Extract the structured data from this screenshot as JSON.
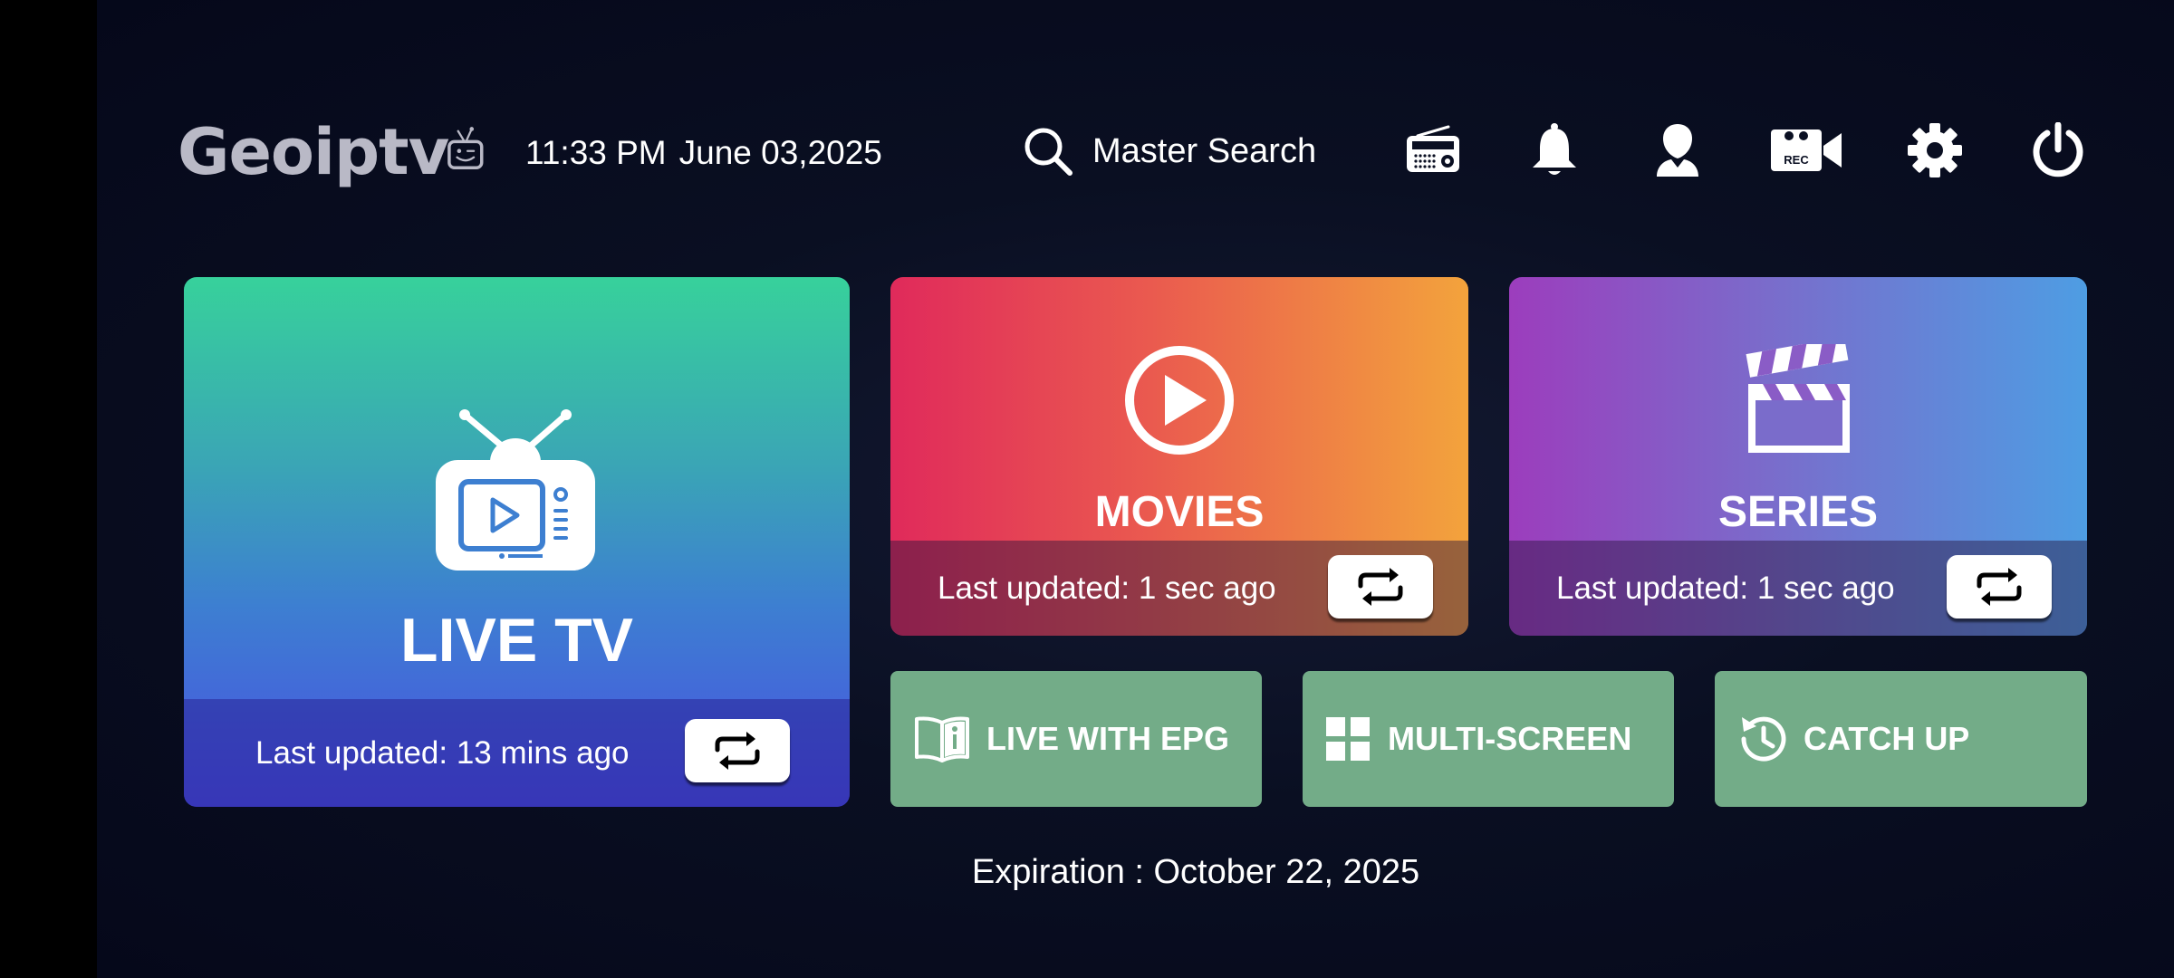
{
  "header": {
    "logo_text": "Geoiptv",
    "time": "11:33 PM",
    "date": "June 03,2025",
    "search_label": "Master Search"
  },
  "top_icons": [
    "radio-icon",
    "bell-icon",
    "user-icon",
    "rec-camera-icon",
    "gear-icon",
    "power-icon"
  ],
  "rec_label": "REC",
  "cards": {
    "live_tv": {
      "title": "LIVE TV",
      "last_updated": "Last updated: 13 mins ago"
    },
    "movies": {
      "title": "MOVIES",
      "last_updated": "Last updated: 1 sec ago"
    },
    "series": {
      "title": "SERIES",
      "last_updated": "Last updated: 1 sec ago"
    }
  },
  "buttons": {
    "live_with_epg": "LIVE WITH EPG",
    "multi_screen": "MULTI-SCREEN",
    "catch_up": "CATCH UP"
  },
  "expiration": "Expiration : October 22, 2025",
  "colors": {
    "live_gradient_top": "#37d19b",
    "live_gradient_bottom": "#4a4fe2",
    "movies_gradient_left": "#e02a5b",
    "movies_gradient_right": "#f3a33c",
    "series_gradient_left": "#9c3dbd",
    "series_gradient_right": "#4e9de3",
    "small_button_green": "#73ac88"
  }
}
